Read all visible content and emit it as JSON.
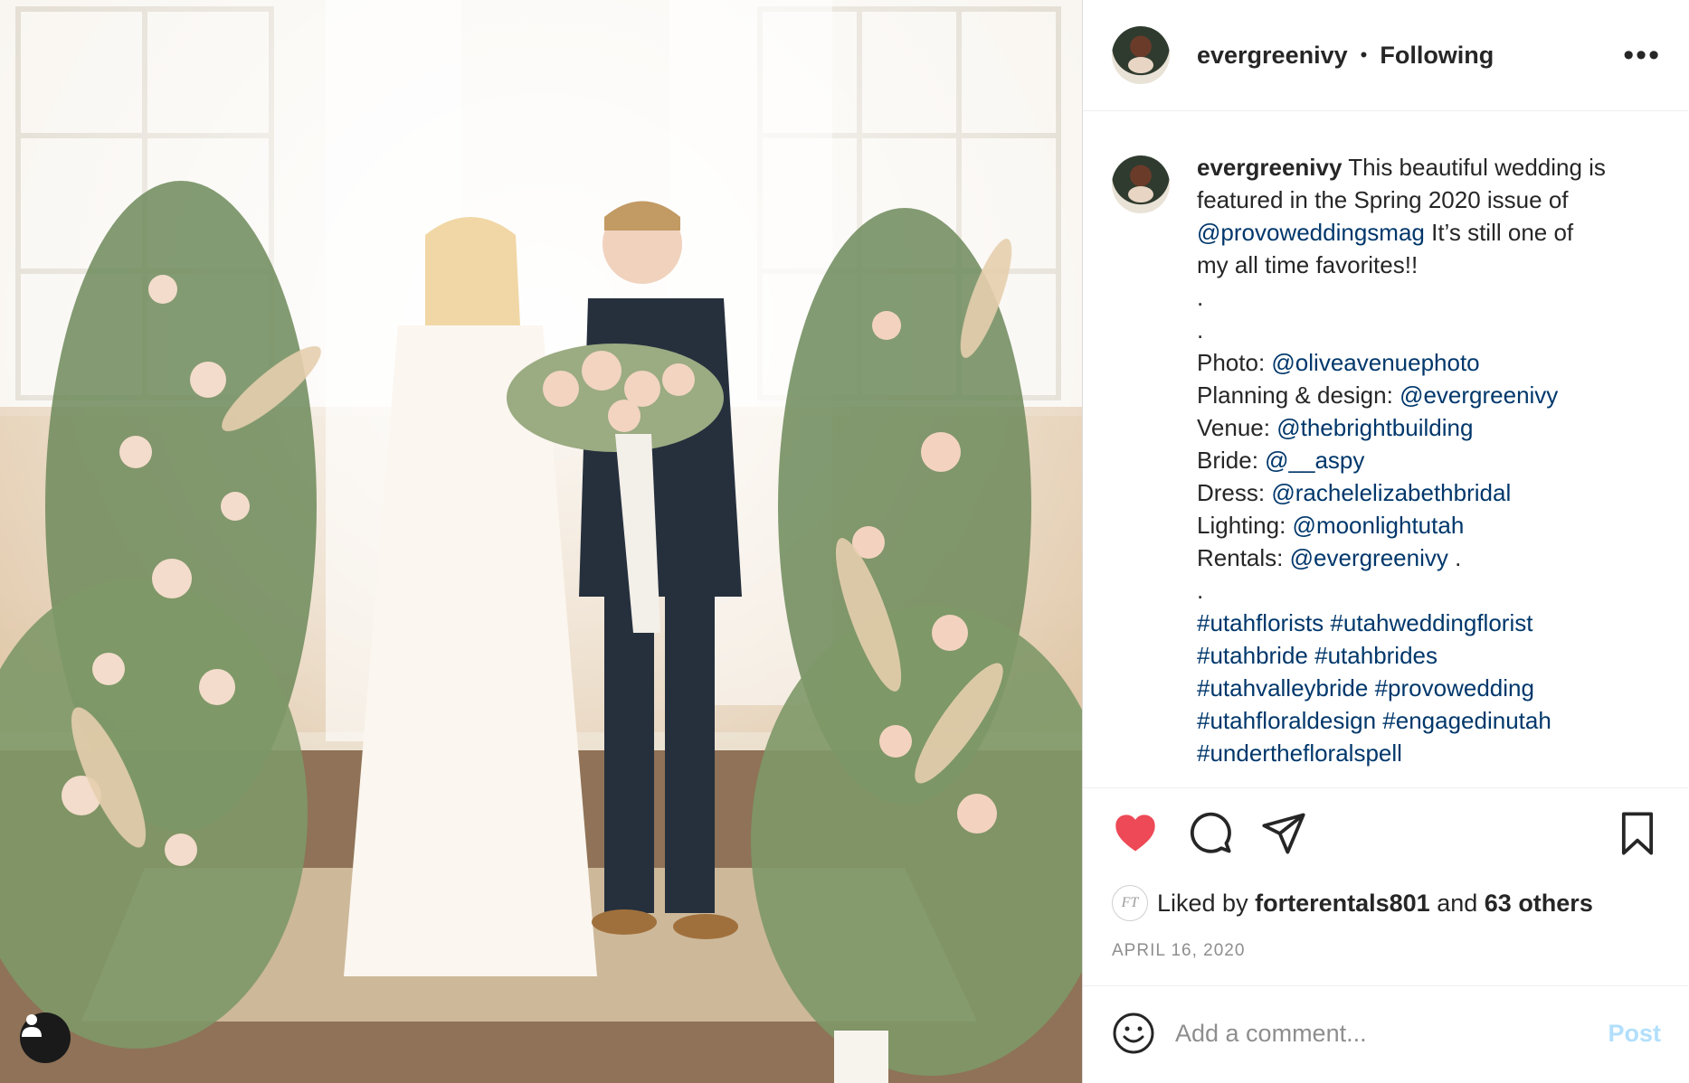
{
  "colors": {
    "heart": "#ed4956",
    "link": "#00376b",
    "post_button": "#b2dffc",
    "meta": "#8e8e8e"
  },
  "photo": {
    "alt_icon": "person-tag-icon"
  },
  "header": {
    "username": "evergreenivy",
    "separator": "•",
    "follow_status": "Following",
    "more_label": "•••"
  },
  "caption": {
    "username": "evergreenivy",
    "text_1": "This beautiful wedding is",
    "text_2": "featured in the Spring 2020 issue of",
    "mention_mag": "@provoweddingsmag",
    "text_3": "It’s still one of",
    "text_4": "my all time favorites!!",
    "dot": ".",
    "credits": [
      {
        "label": "Photo:",
        "handle": "@oliveavenuephoto"
      },
      {
        "label": "Planning & design:",
        "handle": "@evergreenivy"
      },
      {
        "label": "Venue:",
        "handle": "@thebrightbuilding"
      },
      {
        "label": "Bride:",
        "handle": "@__aspy"
      },
      {
        "label": "Dress:",
        "handle": "@rachelelizabethbridal"
      },
      {
        "label": "Lighting:",
        "handle": "@moonlightutah"
      },
      {
        "label": "Rentals:",
        "handle": "@evergreenivy",
        "suffix": "."
      }
    ],
    "hashtag_lines": [
      [
        "#utahflorists",
        "#utahweddingflorist"
      ],
      [
        "#utahbride",
        "#utahbrides"
      ],
      [
        "#utahvalleybride",
        "#provowedding"
      ],
      [
        "#utahfloraldesign",
        "#engagedinutah"
      ],
      [
        "#underthefloralspell"
      ]
    ]
  },
  "actions": {
    "like": "heart-icon",
    "comment": "comment-icon",
    "share": "share-icon",
    "save": "bookmark-icon"
  },
  "likes": {
    "prefix": "Liked by",
    "liker": "forterentals801",
    "connector": "and",
    "others": "63 others",
    "liker_avatar_text": "FT"
  },
  "date": "APRIL 16, 2020",
  "comment_box": {
    "placeholder": "Add a comment...",
    "post_label": "Post"
  }
}
